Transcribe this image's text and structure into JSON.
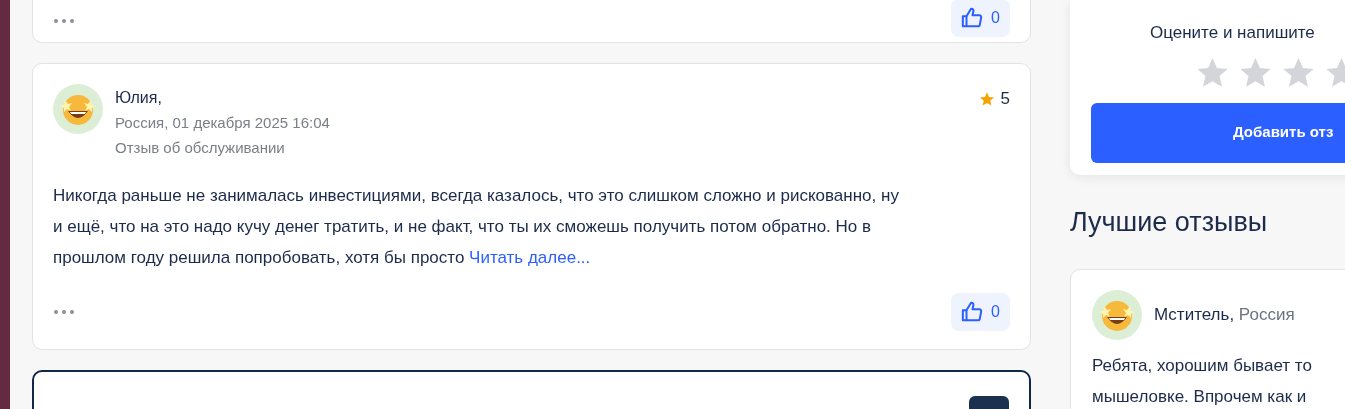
{
  "previous_review": {
    "likes": "0"
  },
  "review": {
    "author": "Юлия,",
    "meta": "Россия, 01 декабря 2025 16:04",
    "category": "Отзыв об обслуживании",
    "rating": "5",
    "text": "Никогда раньше не занималась инвестициями, всегда казалось, что это слишком сложно и рискованно, ну и ещё, что на это надо кучу денег тратить, и не факт, что ты их сможешь получить потом обратно. Но в прошлом году решила попробовать, хотя бы просто",
    "read_more": "Читать далее...",
    "likes": "0"
  },
  "rate_card": {
    "prompt": "Оцените и напишите",
    "stars": 0,
    "button": "Добавить отз"
  },
  "best_reviews": {
    "title": "Лучшие отзывы",
    "items": [
      {
        "author": "Мститель,",
        "country": "Россия",
        "text": "Ребята, хорошим бывает то мышеловке. Впрочем как и"
      }
    ]
  }
}
